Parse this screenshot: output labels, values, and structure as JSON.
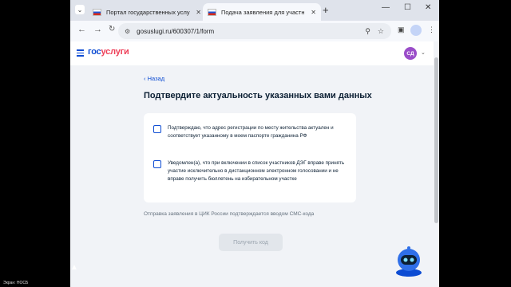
{
  "browser": {
    "tabs": [
      {
        "title": "Портал государственных услу",
        "active": false
      },
      {
        "title": "Подача заявления для участн",
        "active": true
      }
    ],
    "url": "gosuslugi.ru/600307/1/form",
    "icons": [
      "back-icon",
      "forward-icon",
      "reload-icon",
      "site-info-icon",
      "zoom-icon",
      "star-icon",
      "sidepanel-icon",
      "profile-icon",
      "menu-icon"
    ]
  },
  "site": {
    "logo_part1": "гос",
    "logo_part2": "услуги",
    "avatar_initials": "СД",
    "brand_color": "#0d4cd3",
    "accent_color": "#ee3f58"
  },
  "form": {
    "back_label": "‹ Назад",
    "title": "Подтвердите актуальность указанных вами данных",
    "checkboxes": [
      {
        "label": "Подтверждаю, что адрес регистрации по месту жительства актуален и соответствует указанному в моем паспорте гражданина РФ",
        "checked": false
      },
      {
        "label": "Уведомлен(а), что при включении в список участников ДЭГ вправе принять участие исключительно в дистанционном электронном голосовании и не вправе получить бюллетень на избирательном участке",
        "checked": false
      }
    ],
    "note": "Отправка заявления в ЦИК России подтверждается вводом СМС-кода",
    "submit_label": "Получить код"
  },
  "screen": {
    "bottom_label": "Экран: НОСБ"
  }
}
